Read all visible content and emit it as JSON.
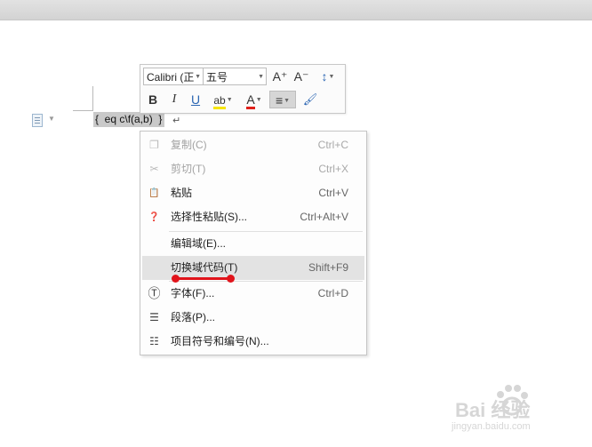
{
  "editor": {
    "field_code": "{  eq c\\f(a,b)  }",
    "paragraph_mark": "↵"
  },
  "mini_toolbar": {
    "font_name": "Calibri (正",
    "font_size": "五号",
    "grow_font": "A⁺",
    "shrink_font": "A⁻",
    "line_spacing": "↕",
    "bold": "B",
    "italic": "I",
    "underline": "U",
    "highlight": "ab",
    "font_color": "A",
    "align": "≡",
    "format_painter": "🖌"
  },
  "context_menu": {
    "items": [
      {
        "label": "复制(C)",
        "shortcut": "Ctrl+C",
        "icon": "copy-icon",
        "glyph": "❐",
        "enabled": false
      },
      {
        "label": "剪切(T)",
        "shortcut": "Ctrl+X",
        "icon": "cut-icon",
        "glyph": "✂",
        "enabled": false
      },
      {
        "label": "粘贴",
        "shortcut": "Ctrl+V",
        "icon": "paste-icon",
        "glyph": "📋",
        "enabled": true
      },
      {
        "label": "选择性粘贴(S)...",
        "shortcut": "Ctrl+Alt+V",
        "icon": "paste-special-icon",
        "glyph": "❓",
        "enabled": true
      },
      {
        "label": "编辑域(E)...",
        "shortcut": "",
        "icon": "",
        "glyph": "",
        "enabled": true
      },
      {
        "label": "切换域代码(T)",
        "shortcut": "Shift+F9",
        "icon": "",
        "glyph": "",
        "enabled": true,
        "highlighted": true
      },
      {
        "label": "字体(F)...",
        "shortcut": "Ctrl+D",
        "icon": "font-icon",
        "glyph": "Ⓣ",
        "enabled": true
      },
      {
        "label": "段落(P)...",
        "shortcut": "",
        "icon": "paragraph-icon",
        "glyph": "☰",
        "enabled": true
      },
      {
        "label": "项目符号和编号(N)...",
        "shortcut": "",
        "icon": "bullets-icon",
        "glyph": "☷",
        "enabled": true
      }
    ]
  },
  "watermark": {
    "brand": "Bai 经验",
    "url": "jingyan.baidu.com"
  },
  "colors": {
    "highlight_yellow": "#f6e500",
    "font_color_red": "#e0201a",
    "annotation_red": "#e1141b"
  }
}
